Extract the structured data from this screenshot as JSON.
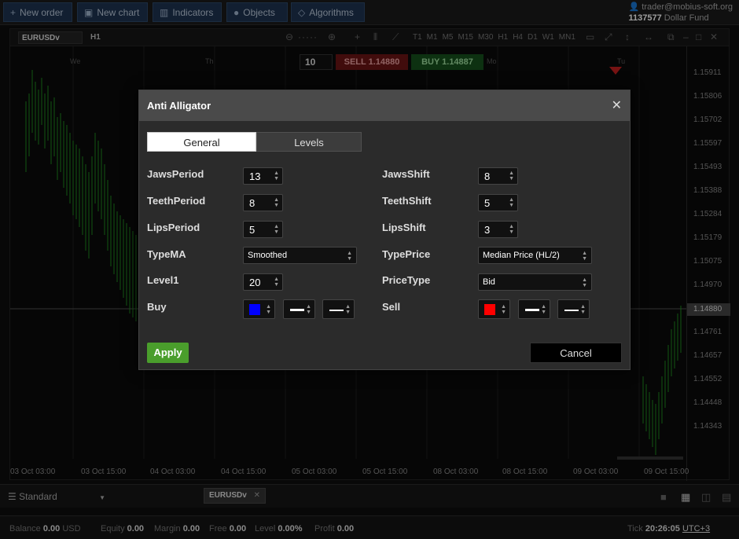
{
  "toolbar": {
    "new_order": "New order",
    "new_chart": "New chart",
    "indicators": "Indicators",
    "objects": "Objects",
    "algorithms": "Algorithms"
  },
  "account": {
    "email": "trader@mobius-soft.org",
    "number": "1137577",
    "fund": "Dollar Fund"
  },
  "chart": {
    "symbol": "EURUSDv",
    "timeframe": "H1",
    "timeframes": [
      "T1",
      "M1",
      "M5",
      "M15",
      "M30",
      "H1",
      "H4",
      "D1",
      "W1",
      "MN1"
    ],
    "quantity": "10",
    "sell_label": "SELL 1.14880",
    "buy_label": "BUY 1.14887",
    "day_labels": [
      "We",
      "Th",
      "Mo",
      "Tu"
    ],
    "current_price": "1.14880",
    "y_ticks": [
      "1.15911",
      "1.15806",
      "1.15702",
      "1.15597",
      "1.15493",
      "1.15388",
      "1.15284",
      "1.15179",
      "1.15075",
      "1.14970",
      "1.14761",
      "1.14657",
      "1.14552",
      "1.14448",
      "1.14343"
    ],
    "x_ticks": [
      "03 Oct 03:00",
      "03 Oct 15:00",
      "04 Oct 03:00",
      "04 Oct 15:00",
      "05 Oct 03:00",
      "05 Oct 15:00",
      "08 Oct 03:00",
      "08 Oct 15:00",
      "09 Oct 03:00",
      "09 Oct 15:00"
    ]
  },
  "bottom": {
    "layout": "Standard",
    "tab": "EURUSDv",
    "balance_label": "Balance",
    "balance": "0.00",
    "currency": "USD",
    "equity_label": "Equity",
    "equity": "0.00",
    "margin_label": "Margin",
    "margin": "0.00",
    "free_label": "Free",
    "free": "0.00",
    "level_label": "Level",
    "level": "0.00%",
    "profit_label": "Profit",
    "profit": "0.00",
    "tick_label": "Tick",
    "time": "20:26:05",
    "tz": "UTC+3"
  },
  "dialog": {
    "title": "Anti Alligator",
    "tabs": [
      "General",
      "Levels"
    ],
    "left_params": [
      {
        "label": "JawsPeriod",
        "value": "13"
      },
      {
        "label": "TeethPeriod",
        "value": "8"
      },
      {
        "label": "LipsPeriod",
        "value": "5"
      },
      {
        "label": "TypeMA",
        "value": "Smoothed"
      },
      {
        "label": "Level1",
        "value": "20"
      },
      {
        "label": "Buy",
        "value": ""
      }
    ],
    "right_params": [
      {
        "label": "JawsShift",
        "value": "8"
      },
      {
        "label": "TeethShift",
        "value": "5"
      },
      {
        "label": "LipsShift",
        "value": "3"
      },
      {
        "label": "TypePrice",
        "value": "Median Price (HL/2)"
      },
      {
        "label": "PriceType",
        "value": "Bid"
      },
      {
        "label": "Sell",
        "value": ""
      }
    ],
    "buy_color": "#0000ff",
    "sell_color": "#ff0000",
    "apply": "Apply",
    "cancel": "Cancel"
  }
}
